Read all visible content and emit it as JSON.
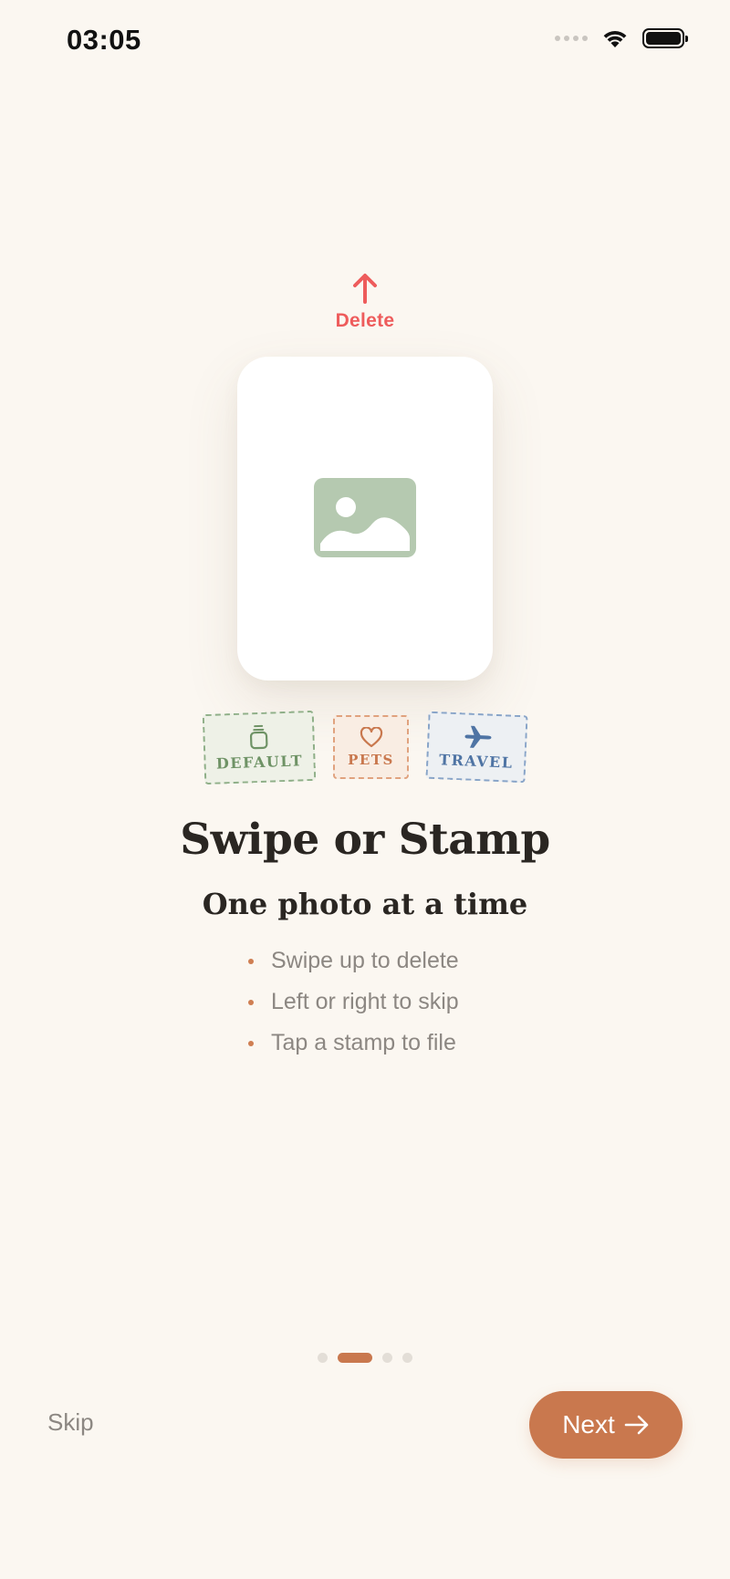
{
  "status_bar": {
    "time": "03:05",
    "icons": [
      "cellular-signal-icon",
      "wifi-icon",
      "battery-icon"
    ]
  },
  "swipe_hint": {
    "icon": "arrow-up-icon",
    "label": "Delete",
    "color": "#EE5C5C"
  },
  "photo_card": {
    "icon": "image-placeholder-icon",
    "icon_color": "#B5C9B0"
  },
  "stamps": [
    {
      "label": "DEFAULT",
      "icon": "jar-icon",
      "color": "#6F9366"
    },
    {
      "label": "PETS",
      "icon": "heart-icon",
      "color": "#C9784E"
    },
    {
      "label": "TRAVEL",
      "icon": "airplane-icon",
      "color": "#4F74A4"
    }
  ],
  "onboarding": {
    "title": "Swipe or Stamp",
    "subtitle": "One photo at a time",
    "bullets": [
      "Swipe up to delete",
      "Left or right to skip",
      "Tap a stamp to file"
    ]
  },
  "pager": {
    "total_pages": 4,
    "current_page": 2
  },
  "actions": {
    "skip_label": "Skip",
    "next_label": "Next"
  },
  "colors": {
    "background": "#FBF7F1",
    "accent": "#C9784E",
    "muted_text": "#8C8782"
  }
}
